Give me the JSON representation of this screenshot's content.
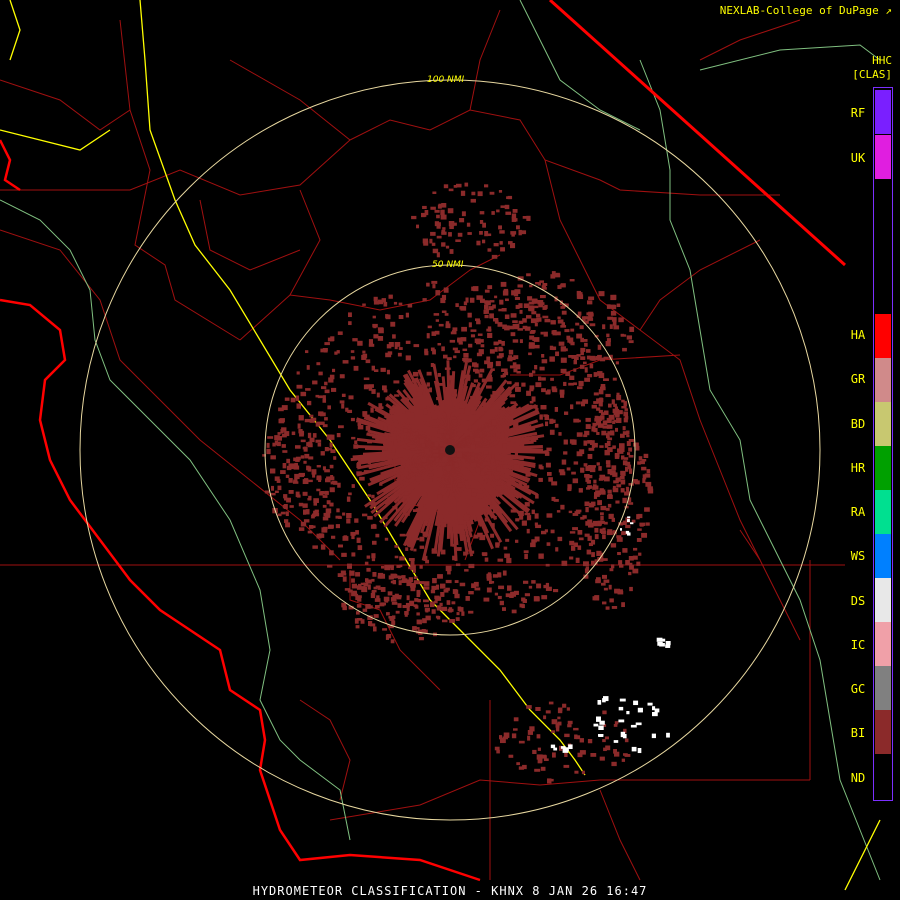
{
  "credit": "NEXLAB-College of DuPage",
  "product": {
    "code": "HHC",
    "class_tag": "[CLAS]"
  },
  "footer": "HYDROMETEOR CLASSIFICATION - KHNX 8 JAN 26 16:47",
  "range_rings": [
    {
      "label": "50 NMI"
    },
    {
      "label": "100 NMI"
    }
  ],
  "legend": [
    {
      "code": "RF",
      "color": "#7a1fff"
    },
    {
      "code": "UK",
      "color": "#e01ee0"
    },
    {
      "code": "HA",
      "color": "#ff0000"
    },
    {
      "code": "GR",
      "color": "#d08a8a"
    },
    {
      "code": "BD",
      "color": "#c8c870"
    },
    {
      "code": "HR",
      "color": "#00a000"
    },
    {
      "code": "RA",
      "color": "#00e090"
    },
    {
      "code": "WS",
      "color": "#0080ff"
    },
    {
      "code": "DS",
      "color": "#e8e8e8"
    },
    {
      "code": "IC",
      "color": "#f0a0a8"
    },
    {
      "code": "GC",
      "color": "#808080"
    },
    {
      "code": "BI",
      "color": "#8b2a2a"
    },
    {
      "code": "ND",
      "color": "#000000"
    }
  ],
  "colors": {
    "county_lines": "#b01010",
    "coast": "#ff0000",
    "highway": "#ffff00",
    "rings": "#e8d8a0",
    "terrain": "#80c080",
    "echo_bi": "#8b2a2a",
    "echo_ds": "#ffffff"
  }
}
